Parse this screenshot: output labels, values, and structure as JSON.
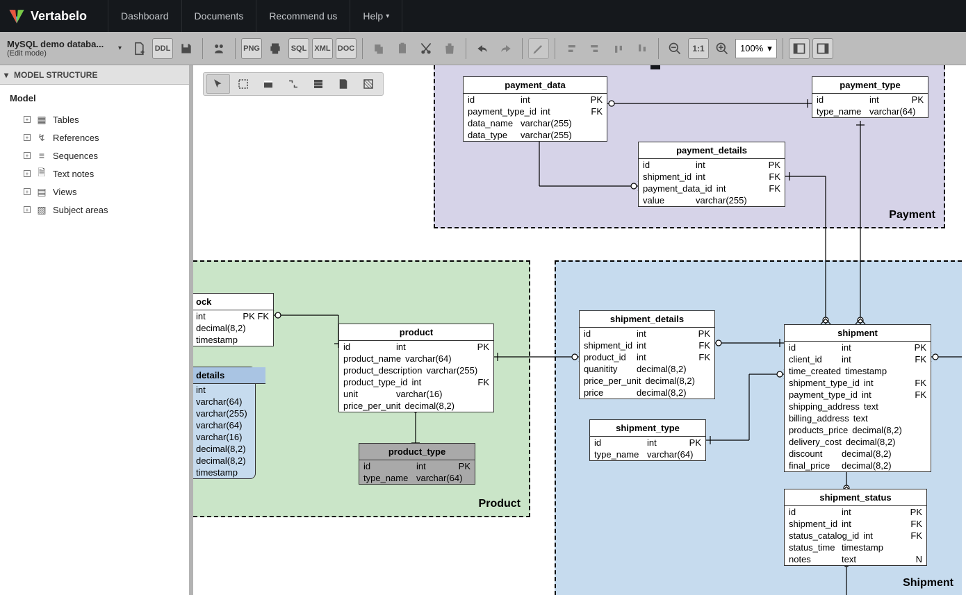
{
  "app_name": "Vertabelo",
  "nav": {
    "items": [
      "Dashboard",
      "Documents",
      "Recommend us",
      "Help"
    ]
  },
  "doc": {
    "title": "MySQL demo databa...",
    "mode": "(Edit mode)"
  },
  "zoom": "100%",
  "sidebar": {
    "heading": "MODEL STRUCTURE",
    "root": "Model",
    "items": [
      {
        "label": "Tables"
      },
      {
        "label": "References"
      },
      {
        "label": "Sequences"
      },
      {
        "label": "Text notes"
      },
      {
        "label": "Views"
      },
      {
        "label": "Subject areas"
      }
    ]
  },
  "areas": {
    "payment": {
      "label": "Payment"
    },
    "product": {
      "label": "Product"
    },
    "shipment": {
      "label": "Shipment"
    }
  },
  "tables": {
    "payment_data": {
      "name": "payment_data",
      "cols": [
        {
          "name": "id",
          "type": "int",
          "key": "PK"
        },
        {
          "name": "payment_type_id",
          "type": "int",
          "key": "FK"
        },
        {
          "name": "data_name",
          "type": "varchar(255)",
          "key": ""
        },
        {
          "name": "data_type",
          "type": "varchar(255)",
          "key": ""
        }
      ]
    },
    "payment_type": {
      "name": "payment_type",
      "cols": [
        {
          "name": "id",
          "type": "int",
          "key": "PK"
        },
        {
          "name": "type_name",
          "type": "varchar(64)",
          "key": ""
        }
      ]
    },
    "payment_details": {
      "name": "payment_details",
      "cols": [
        {
          "name": "id",
          "type": "int",
          "key": "PK"
        },
        {
          "name": "shipment_id",
          "type": "int",
          "key": "FK"
        },
        {
          "name": "payment_data_id",
          "type": "int",
          "key": "FK"
        },
        {
          "name": "value",
          "type": "varchar(255)",
          "key": ""
        }
      ]
    },
    "stock_partial": {
      "name": "ock",
      "cols": [
        {
          "name": "",
          "type": "int",
          "key": "PK FK"
        },
        {
          "name": "",
          "type": "decimal(8,2)",
          "key": ""
        },
        {
          "name": "",
          "type": "timestamp",
          "key": ""
        }
      ]
    },
    "details_partial": {
      "name": "details",
      "cols": [
        {
          "name": "",
          "type": "int",
          "key": ""
        },
        {
          "name": "",
          "type": "varchar(64)",
          "key": ""
        },
        {
          "name": "",
          "type": "varchar(255)",
          "key": ""
        },
        {
          "name": "",
          "type": "varchar(64)",
          "key": ""
        },
        {
          "name": "",
          "type": "varchar(16)",
          "key": ""
        },
        {
          "name": "",
          "type": "decimal(8,2)",
          "key": ""
        },
        {
          "name": "",
          "type": "decimal(8,2)",
          "key": ""
        },
        {
          "name": "",
          "type": "timestamp",
          "key": ""
        }
      ]
    },
    "product": {
      "name": "product",
      "cols": [
        {
          "name": "id",
          "type": "int",
          "key": "PK"
        },
        {
          "name": "product_name",
          "type": "varchar(64)",
          "key": ""
        },
        {
          "name": "product_description",
          "type": "varchar(255)",
          "key": ""
        },
        {
          "name": "product_type_id",
          "type": "int",
          "key": "FK"
        },
        {
          "name": "unit",
          "type": "varchar(16)",
          "key": ""
        },
        {
          "name": "price_per_unit",
          "type": "decimal(8,2)",
          "key": ""
        }
      ]
    },
    "product_type": {
      "name": "product_type",
      "cols": [
        {
          "name": "id",
          "type": "int",
          "key": "PK"
        },
        {
          "name": "type_name",
          "type": "varchar(64)",
          "key": ""
        }
      ]
    },
    "shipment_details": {
      "name": "shipment_details",
      "cols": [
        {
          "name": "id",
          "type": "int",
          "key": "PK"
        },
        {
          "name": "shipment_id",
          "type": "int",
          "key": "FK"
        },
        {
          "name": "product_id",
          "type": "int",
          "key": "FK"
        },
        {
          "name": "quanitity",
          "type": "decimal(8,2)",
          "key": ""
        },
        {
          "name": "price_per_unit",
          "type": "decimal(8,2)",
          "key": ""
        },
        {
          "name": "price",
          "type": "decimal(8,2)",
          "key": ""
        }
      ]
    },
    "shipment": {
      "name": "shipment",
      "cols": [
        {
          "name": "id",
          "type": "int",
          "key": "PK"
        },
        {
          "name": "client_id",
          "type": "int",
          "key": "FK"
        },
        {
          "name": "time_created",
          "type": "timestamp",
          "key": ""
        },
        {
          "name": "shipment_type_id",
          "type": "int",
          "key": "FK"
        },
        {
          "name": "payment_type_id",
          "type": "int",
          "key": "FK"
        },
        {
          "name": "shipping_address",
          "type": "text",
          "key": ""
        },
        {
          "name": "billing_address",
          "type": "text",
          "key": ""
        },
        {
          "name": "products_price",
          "type": "decimal(8,2)",
          "key": ""
        },
        {
          "name": "delivery_cost",
          "type": "decimal(8,2)",
          "key": ""
        },
        {
          "name": "discount",
          "type": "decimal(8,2)",
          "key": ""
        },
        {
          "name": "final_price",
          "type": "decimal(8,2)",
          "key": ""
        }
      ]
    },
    "shipment_type": {
      "name": "shipment_type",
      "cols": [
        {
          "name": "id",
          "type": "int",
          "key": "PK"
        },
        {
          "name": "type_name",
          "type": "varchar(64)",
          "key": ""
        }
      ]
    },
    "shipment_status": {
      "name": "shipment_status",
      "cols": [
        {
          "name": "id",
          "type": "int",
          "key": "PK"
        },
        {
          "name": "shipment_id",
          "type": "int",
          "key": "FK"
        },
        {
          "name": "status_catalog_id",
          "type": "int",
          "key": "FK"
        },
        {
          "name": "status_time",
          "type": "timestamp",
          "key": ""
        },
        {
          "name": "notes",
          "type": "text",
          "key": "N"
        }
      ]
    }
  }
}
